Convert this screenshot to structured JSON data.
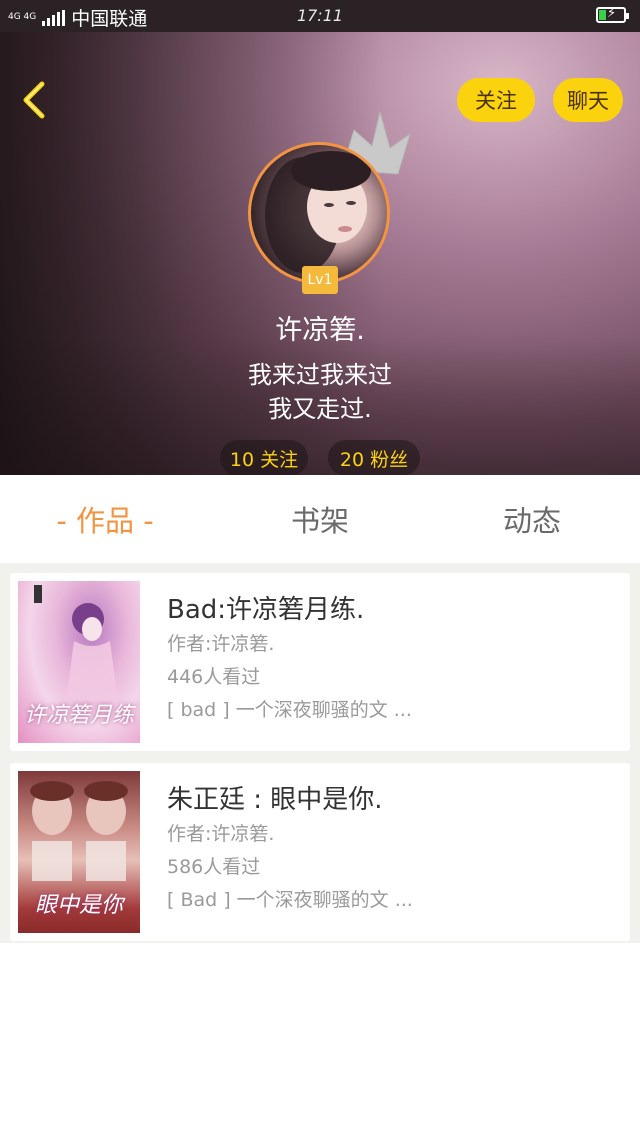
{
  "status_bar": {
    "network": "4G 4G",
    "carrier": "中国联通",
    "time": "17:11"
  },
  "header": {
    "follow_label": "关注",
    "chat_label": "聊天",
    "level": "Lv1",
    "username": "许凉箬.",
    "bio_line1": "我来过我来过",
    "bio_line2": "我又走过.",
    "following": "10 关注",
    "fans": "20 粉丝"
  },
  "tabs": {
    "works": "- 作品 -",
    "shelf": "书架",
    "feed": "动态"
  },
  "books": [
    {
      "title": "Bad:许凉箬月练.",
      "author": "作者:许凉箬.",
      "views": "446人看过",
      "desc": "[ bad ] 一个深夜聊骚的文 ...",
      "cover_text": "许凉箬月练"
    },
    {
      "title": "朱正廷 : 眼中是你.",
      "author": "作者:许凉箬.",
      "views": "586人看过",
      "desc": "[ Bad ] 一个深夜聊骚的文 ...",
      "cover_text": "眼中是你"
    }
  ],
  "colors": {
    "accent_yellow": "#fbd20e",
    "accent_orange": "#f29442",
    "battery_green": "#3ad14a"
  }
}
